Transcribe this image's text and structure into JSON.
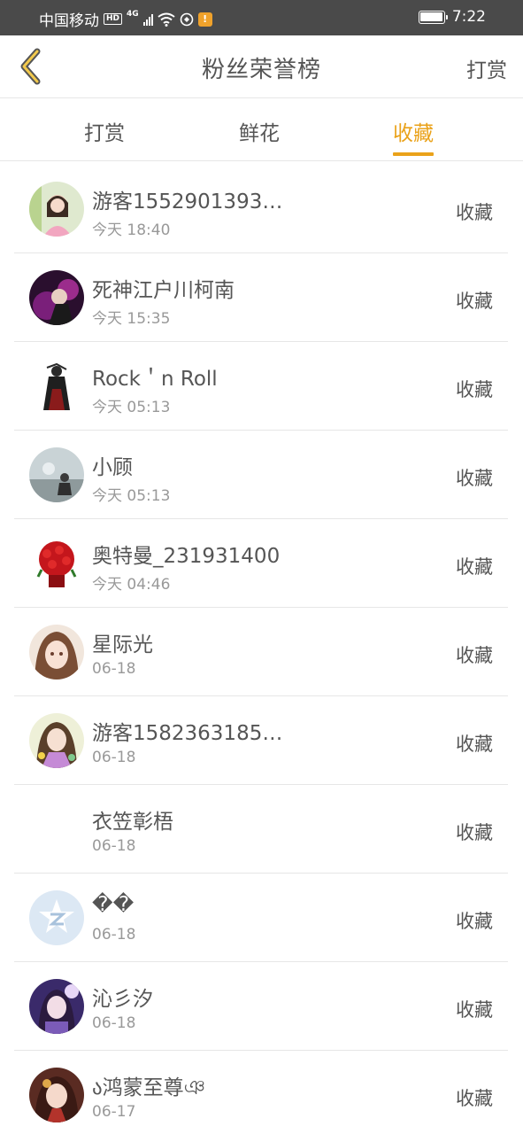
{
  "status_bar": {
    "carrier": "中国移动",
    "hd_badge": "HD",
    "network": "4G",
    "notify_badge": "!",
    "time": "7:22",
    "battery_level_percent": 100
  },
  "header": {
    "back_icon": "chevron-left-icon",
    "title": "粉丝荣誉榜",
    "right_action": "打赏"
  },
  "tabs": [
    {
      "label": "打赏",
      "active": false
    },
    {
      "label": "鲜花",
      "active": false
    },
    {
      "label": "收藏",
      "active": true
    }
  ],
  "accent_color": "#eaa21a",
  "fans": [
    {
      "name": "游客1552901393…",
      "time": "今天 18:40",
      "action": "收藏"
    },
    {
      "name": "死神江户川柯南",
      "time": "今天 15:35",
      "action": "收藏"
    },
    {
      "name": "Rock＇n Roll",
      "time": "今天 05:13",
      "action": "收藏"
    },
    {
      "name": "小顾",
      "time": "今天 05:13",
      "action": "收藏"
    },
    {
      "name": "奥特曼_231931400",
      "time": "今天 04:46",
      "action": "收藏"
    },
    {
      "name": "星际光",
      "time": "06-18",
      "action": "收藏"
    },
    {
      "name": "游客1582363185…",
      "time": "06-18",
      "action": "收藏"
    },
    {
      "name": "衣笠彰梧",
      "time": "06-18",
      "action": "收藏"
    },
    {
      "name": "��",
      "time": "06-18",
      "action": "收藏"
    },
    {
      "name": "沁彡汐",
      "time": "06-18",
      "action": "收藏"
    },
    {
      "name": "ა鸿蒙至尊ঞ",
      "time": "06-17",
      "action": "收藏"
    }
  ]
}
